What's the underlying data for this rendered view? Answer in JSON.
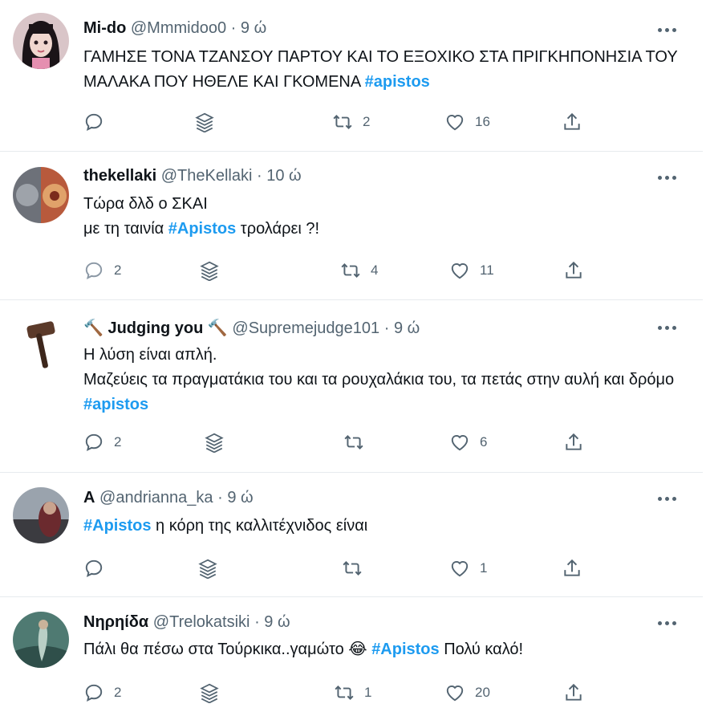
{
  "tweets": [
    {
      "name": "Mi-do",
      "name_emoji": "",
      "handle": "@Mmmidoo0",
      "time": "9 ώ",
      "text_before": "ΓΑΜΗΣΕ ΤΟΝΑ ΤΖΑΝΣΟΥ ΠΑΡΤΟΥ ΚΑΙ ΤΟ ΕΞΟΧΙΚΟ ΣΤΑ ΠΡΙΓΚΗΠΟΝΗΣΙΑ ΤΟΥ ΜΑΛΑΚΑ ΠΟΥ ΗΘΕΛΕ ΚΑΙ ΓΚΟΜΕΝΑ ",
      "hashtag": "#apistos",
      "text_after": "",
      "replies": "",
      "retweets": "2",
      "likes": "16"
    },
    {
      "name": "thekellaki",
      "handle": "@TheKellaki",
      "time": "10 ώ",
      "text_line1": "Τώρα δλδ ο ΣΚΑΙ",
      "text_before": "με τη ταινία ",
      "hashtag": "#Apistos",
      "text_after": " τρολάρει ?!",
      "replies": "2",
      "retweets": "4",
      "likes": "11"
    },
    {
      "name": "Judging you",
      "name_emoji_left": "🔨",
      "name_emoji_right": "🔨",
      "handle": "@Supremejudge101",
      "time": "9 ώ",
      "text_line1": "Η λύση είναι απλή.",
      "text_before": "Μαζεύεις τα πραγματάκια του και τα ρουχαλάκια του, τα πετάς στην αυλή και δρόμο ",
      "hashtag": "#apistos",
      "text_after": "",
      "replies": "2",
      "retweets": "",
      "likes": "6"
    },
    {
      "name": "A",
      "handle": "@andrianna_ka",
      "time": "9 ώ",
      "hashtag": "#Apistos",
      "text_after": " η κόρη της καλλιτέχνιδος είναι",
      "replies": "",
      "retweets": "",
      "likes": "1"
    },
    {
      "name": "Νηρηίδα",
      "handle": "@Trelokatsiki",
      "time": "9 ώ",
      "text_before": "Πάλι θα πέσω στα Τούρκικα..γαμώτο ",
      "emoji": "😂",
      "hashtag": "#Apistos",
      "text_after": " Πολύ καλό!",
      "replies": "2",
      "retweets": "1",
      "likes": "20"
    }
  ],
  "separator": "·",
  "colors": {
    "accent": "#1d9bf0",
    "muted": "#536471",
    "divider": "#e7ebee"
  }
}
